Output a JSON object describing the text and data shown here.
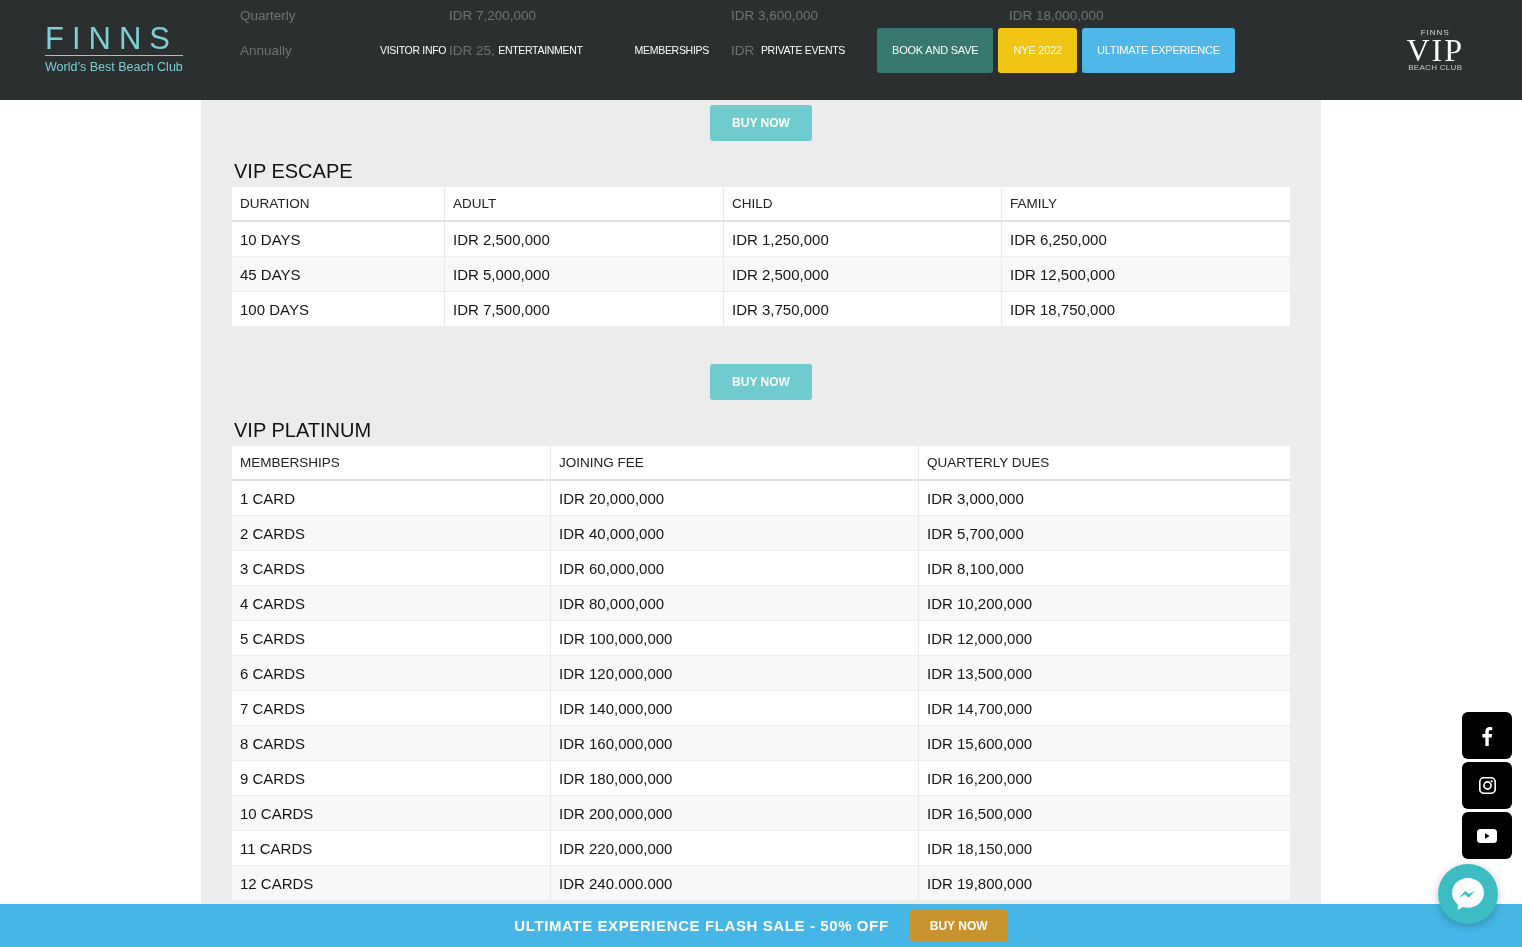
{
  "header": {
    "logo": {
      "wordmark": "FINNS",
      "tagline": "World’s Best Beach Club"
    },
    "nav": [
      "VISITOR INFO",
      "ENTERTAINMENT",
      "MEMBERSHIPS",
      "PRIVATE EVENTS"
    ],
    "buttons": [
      {
        "label": "BOOK AND SAVE",
        "color": "#38786f"
      },
      {
        "label": "NYE 2022",
        "color": "#f2c515"
      },
      {
        "label": "ULTIMATE EXPERIENCE",
        "color": "#4fb8e8"
      }
    ],
    "badge": {
      "top": "FINNS",
      "title": "VIP",
      "bottom": "BEACH CLUB"
    }
  },
  "previous_table": {
    "rows": [
      [
        "Quarterly",
        "IDR 7,200,000",
        "IDR 3,600,000",
        "IDR 18,000,000"
      ],
      [
        "Annually",
        "IDR 25,",
        "IDR"
      ]
    ]
  },
  "sections": [
    {
      "button": "BUY NOW",
      "title": "VIP ESCAPE",
      "columns": [
        "DURATION",
        "ADULT",
        "CHILD",
        "FAMILY"
      ],
      "rows": [
        [
          "10 DAYS",
          "IDR 2,500,000",
          "IDR 1,250,000",
          "IDR 6,250,000"
        ],
        [
          "45 DAYS",
          "IDR 5,000,000",
          "IDR 2,500,000",
          "IDR 12,500,000"
        ],
        [
          "100 DAYS",
          "IDR 7,500,000",
          "IDR 3,750,000",
          "IDR 18,750,000"
        ]
      ]
    },
    {
      "button": "BUY NOW",
      "title": "VIP PLATINUM",
      "columns": [
        "MEMBERSHIPS",
        "JOINING FEE",
        "QUARTERLY DUES"
      ],
      "rows": [
        [
          "1 CARD",
          "IDR 20,000,000",
          "IDR 3,000,000"
        ],
        [
          "2 CARDS",
          "IDR 40,000,000",
          "IDR 5,700,000"
        ],
        [
          "3 CARDS",
          "IDR 60,000,000",
          "IDR 8,100,000"
        ],
        [
          "4 CARDS",
          "IDR 80,000,000",
          "IDR 10,200,000"
        ],
        [
          "5 CARDS",
          "IDR 100,000,000",
          "IDR 12,000,000"
        ],
        [
          "6 CARDS",
          "IDR 120,000,000",
          "IDR 13,500,000"
        ],
        [
          "7 CARDS",
          "IDR 140,000,000",
          "IDR 14,700,000"
        ],
        [
          "8 CARDS",
          "IDR 160,000,000",
          "IDR 15,600,000"
        ],
        [
          "9 CARDS",
          "IDR 180,000,000",
          "IDR 16,200,000"
        ],
        [
          "10 CARDS",
          "IDR 200,000,000",
          "IDR 16,500,000"
        ],
        [
          "11 CARDS",
          "IDR 220,000,000",
          "IDR 18,150,000"
        ],
        [
          "12 CARDS",
          "IDR 240.000.000",
          "IDR 19,800,000"
        ]
      ]
    }
  ],
  "flash_sale": {
    "text": "ULTIMATE EXPERIENCE FLASH SALE - 50% OFF",
    "button": "BUY NOW"
  }
}
